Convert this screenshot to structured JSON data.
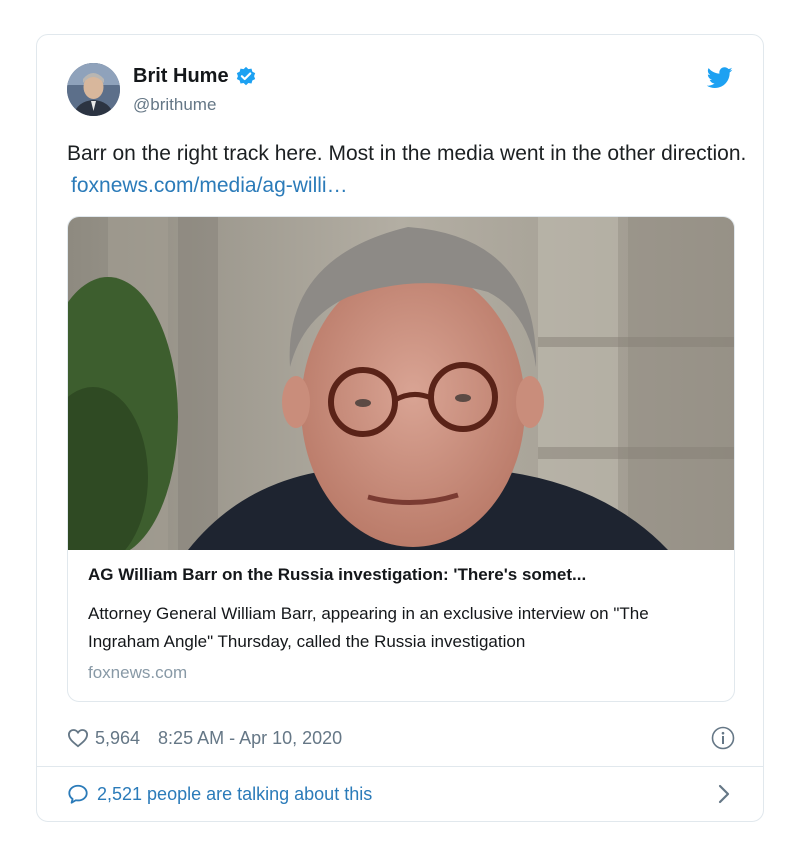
{
  "author": {
    "name": "Brit Hume",
    "handle": "@brithume",
    "avatar_icon": "profile-photo",
    "verified_icon": "verified-badge-icon"
  },
  "tweet": {
    "text": "Barr on the right track here. Most in the media went in the other direction.",
    "link": "foxnews.com/media/ag-willi…"
  },
  "card": {
    "image_icon": "news-photo",
    "title": "AG William Barr on the Russia investigation: 'There's somet...",
    "description": "Attorney General William Barr, appearing in an exclusive interview on \"The Ingraham Angle\" Thursday, called the Russia investigation",
    "domain": "foxnews.com"
  },
  "meta": {
    "likes": "5,964",
    "timestamp": "8:25 AM - Apr 10, 2020"
  },
  "footer": {
    "talking": "2,521 people are talking about this"
  },
  "colors": {
    "link": "#2b7bb9",
    "twitter_blue": "#1da1f2",
    "secondary_text": "#657786",
    "border": "#e1e8ed"
  }
}
